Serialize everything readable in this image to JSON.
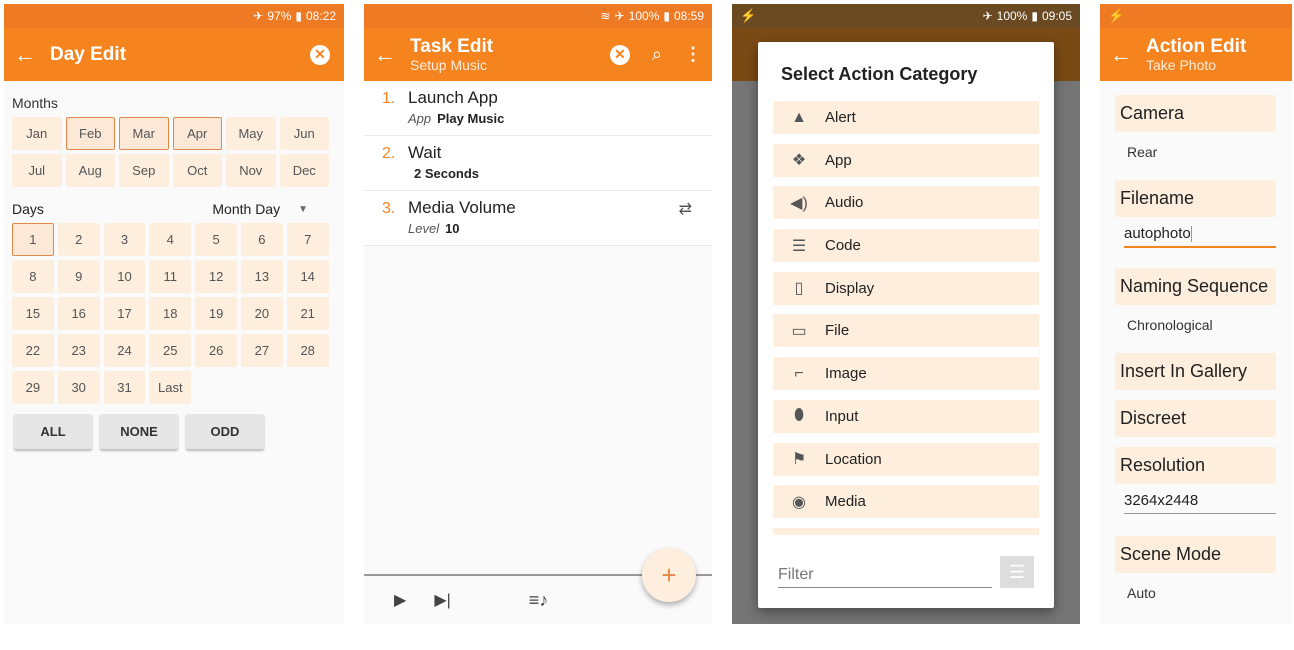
{
  "screen1": {
    "status": {
      "plane": "✈",
      "battery": "97%",
      "batt_icon": "▮",
      "time": "08:22"
    },
    "appbar": {
      "title": "Day Edit"
    },
    "months_label": "Months",
    "months": [
      "Jan",
      "Feb",
      "Mar",
      "Apr",
      "May",
      "Jun",
      "Jul",
      "Aug",
      "Sep",
      "Oct",
      "Nov",
      "Dec"
    ],
    "selected_months": [
      "Feb",
      "Mar",
      "Apr"
    ],
    "days_label": "Days",
    "days_mode": "Month Day",
    "days": [
      "1",
      "2",
      "3",
      "4",
      "5",
      "6",
      "7",
      "8",
      "9",
      "10",
      "11",
      "12",
      "13",
      "14",
      "15",
      "16",
      "17",
      "18",
      "19",
      "20",
      "21",
      "22",
      "23",
      "24",
      "25",
      "26",
      "27",
      "28",
      "29",
      "30",
      "31",
      "Last"
    ],
    "selected_days": [
      "1"
    ],
    "buttons": {
      "all": "ALL",
      "none": "NONE",
      "odd": "ODD"
    }
  },
  "screen2": {
    "status": {
      "wifi": "≋",
      "plane": "✈",
      "battery": "100%",
      "batt_icon": "▮",
      "time": "08:59"
    },
    "appbar": {
      "title": "Task Edit",
      "subtitle": "Setup Music"
    },
    "tasks": [
      {
        "num": "1.",
        "name": "Launch App",
        "param_label": "App",
        "param_value": "Play Music"
      },
      {
        "num": "2.",
        "name": "Wait",
        "param_label": "",
        "param_value": "2 Seconds"
      },
      {
        "num": "3.",
        "name": "Media Volume",
        "param_label": "Level",
        "param_value": "10"
      }
    ]
  },
  "screen3": {
    "status": {
      "bolt": "⚡",
      "plane": "✈",
      "battery": "100%",
      "batt_icon": "▮",
      "time": "09:05"
    },
    "dialog_title": "Select Action Category",
    "categories": [
      {
        "label": "Alert",
        "icon": "▲"
      },
      {
        "label": "App",
        "icon": "❖"
      },
      {
        "label": "Audio",
        "icon": "◀)"
      },
      {
        "label": "Code",
        "icon": "☰"
      },
      {
        "label": "Display",
        "icon": "▯"
      },
      {
        "label": "File",
        "icon": "▭"
      },
      {
        "label": "Image",
        "icon": "⌐"
      },
      {
        "label": "Input",
        "icon": "⬮"
      },
      {
        "label": "Location",
        "icon": "⚑"
      },
      {
        "label": "Media",
        "icon": "◉"
      }
    ],
    "filter_placeholder": "Filter"
  },
  "screen4": {
    "status": {
      "bolt": "⚡"
    },
    "appbar": {
      "title": "Action Edit",
      "subtitle": "Take Photo"
    },
    "camera": {
      "label": "Camera",
      "value": "Rear"
    },
    "filename": {
      "label": "Filename",
      "value": "autophoto"
    },
    "naming": {
      "label": "Naming Sequence",
      "value": "Chronological"
    },
    "gallery": {
      "label": "Insert In Gallery"
    },
    "discreet": {
      "label": "Discreet"
    },
    "resolution": {
      "label": "Resolution",
      "value": "3264x2448"
    },
    "scene": {
      "label": "Scene Mode",
      "value": "Auto"
    }
  },
  "colors": {
    "accent": "#f5841f",
    "status": "#ef7a24",
    "chip": "#fdeedd"
  }
}
